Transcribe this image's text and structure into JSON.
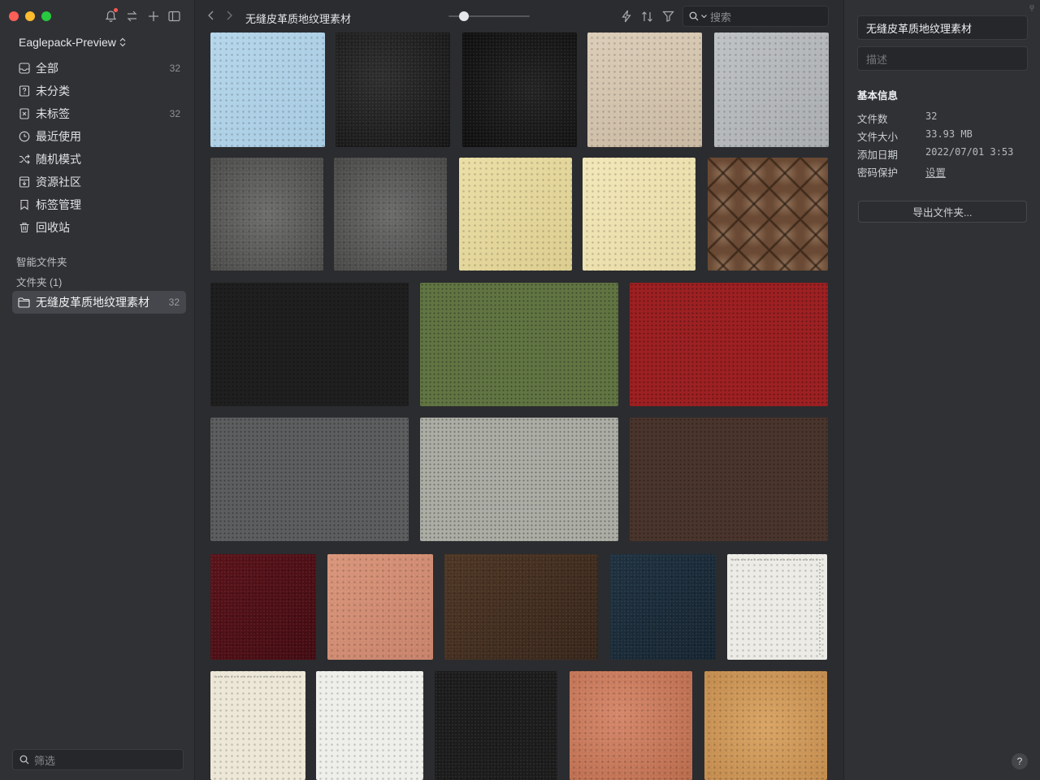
{
  "sidebar": {
    "library_name": "Eaglepack-Preview",
    "items": [
      {
        "label": "全部",
        "count": "32",
        "icon": "inbox-icon"
      },
      {
        "label": "未分类",
        "count": "",
        "icon": "question-icon"
      },
      {
        "label": "未标签",
        "count": "32",
        "icon": "untagged-icon"
      },
      {
        "label": "最近使用",
        "count": "",
        "icon": "clock-icon"
      },
      {
        "label": "随机模式",
        "count": "",
        "icon": "shuffle-icon"
      },
      {
        "label": "资源社区",
        "count": "",
        "icon": "download-box-icon"
      },
      {
        "label": "标签管理",
        "count": "",
        "icon": "bookmark-icon"
      },
      {
        "label": "回收站",
        "count": "",
        "icon": "trash-icon"
      }
    ],
    "smart_folders_label": "智能文件夹",
    "folders_label": "文件夹 (1)",
    "folder": {
      "label": "无缝皮革质地纹理素材",
      "count": "32"
    },
    "filter_placeholder": "筛选"
  },
  "toolbar": {
    "folder_title": "无缝皮革质地纹理素材",
    "thumbnail_size": 0.15,
    "search_placeholder": "搜索"
  },
  "inspector": {
    "name": "无缝皮革质地纹理素材",
    "description_placeholder": "描述",
    "section_title": "基本信息",
    "rows": [
      {
        "key": "文件数",
        "value": "32"
      },
      {
        "key": "文件大小",
        "value": "33.93 MB"
      },
      {
        "key": "添加日期",
        "value": "2022/07/01 3:53"
      },
      {
        "key": "密码保护",
        "value": "设置"
      }
    ],
    "export_label": "导出文件夹...",
    "help_label": "?"
  },
  "colors": {
    "accent_red": "#fe5f57",
    "accent_yellow": "#febc2e",
    "accent_green": "#28c840"
  }
}
